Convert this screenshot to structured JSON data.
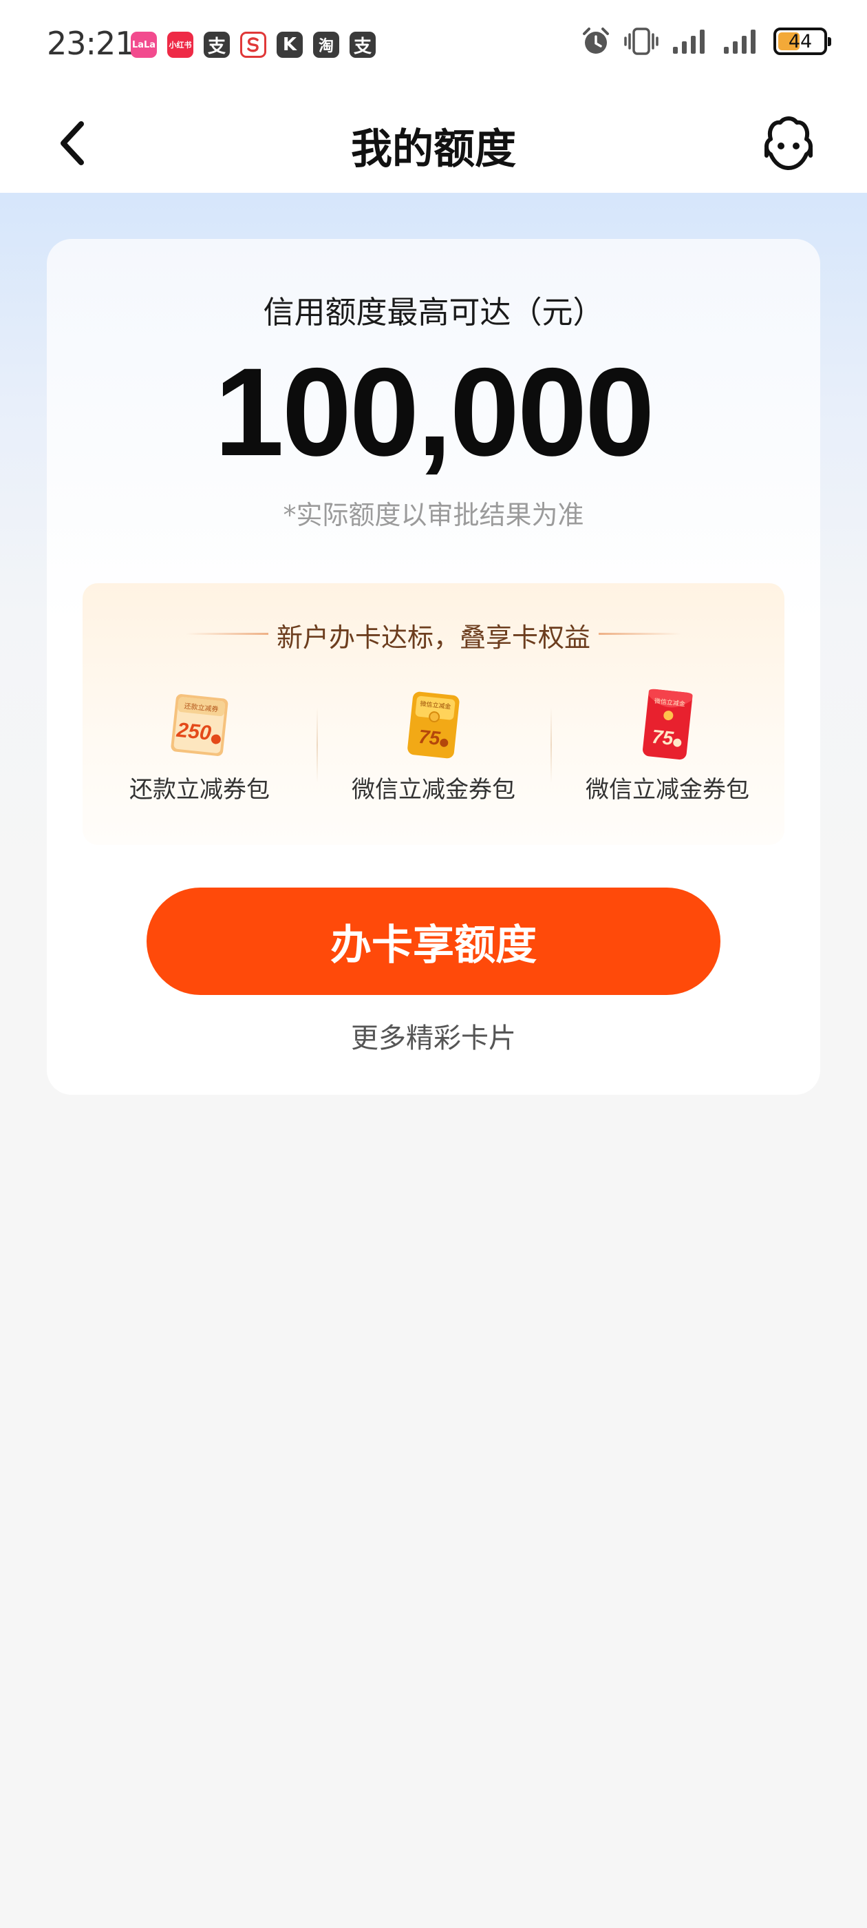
{
  "status_bar": {
    "time": "23:21",
    "apps": [
      "lala-app",
      "xiaohongshu-app",
      "alipay-app",
      "sogou-app",
      "k-app",
      "taobao-app",
      "alipay-app-2"
    ],
    "app_glyphs": {
      "lala": "LaLa",
      "xhs": "小红书",
      "zhi": "支",
      "kk": "K",
      "tao": "淘"
    },
    "battery": "44",
    "battery_level": 0.44
  },
  "nav": {
    "title": "我的额度"
  },
  "quota": {
    "label": "信用额度最高可达（元）",
    "value": "100,000",
    "note": "*实际额度以审批结果为准"
  },
  "benefits": {
    "title": "新户办卡达标，叠享卡权益",
    "items": [
      {
        "label": "还款立减券包",
        "amount": "250",
        "badge": "还款立减券",
        "icon": "repay-coupon-icon"
      },
      {
        "label": "微信立减金券包",
        "amount": "75",
        "badge": "微信立减金",
        "icon": "wechat-coupon-gold-icon"
      },
      {
        "label": "微信立减金券包",
        "amount": "75",
        "badge": "微信立减金",
        "icon": "wechat-red-envelope-icon"
      }
    ]
  },
  "cta": {
    "label": "办卡享额度"
  },
  "more": {
    "label": "更多精彩卡片"
  },
  "colors": {
    "accent": "#ff4a0a",
    "hero_top": "#d6e6fb",
    "benefit_bg": "#fff3e3"
  }
}
